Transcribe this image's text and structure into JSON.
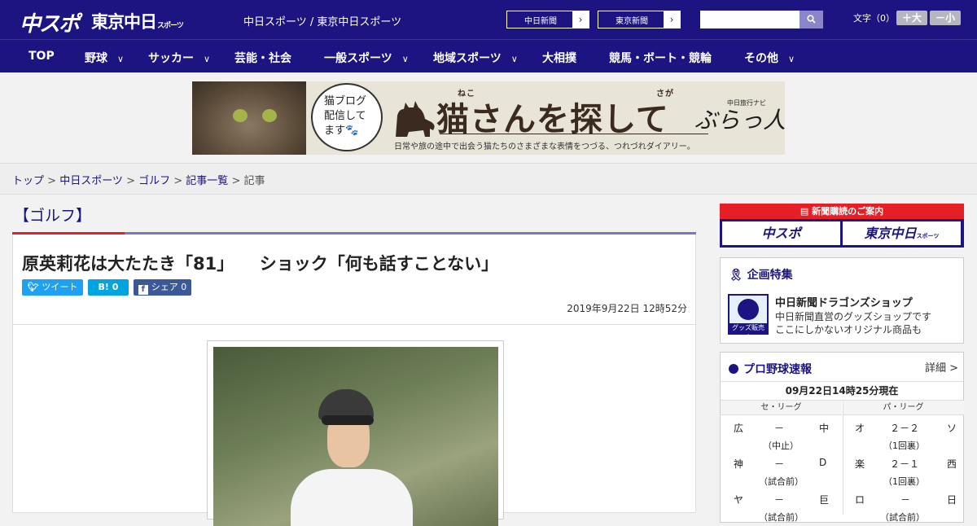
{
  "header": {
    "logo_main": "中スポ",
    "logo_tokyo": "東京中日",
    "logo_tokyo_suffix": "スポーツ",
    "site_links": "中日スポーツ / 東京中日スポーツ",
    "chunichi_shimbun": "中日新聞",
    "tokyo_shimbun": "東京新聞",
    "arrow": "›",
    "search_placeholder": "",
    "font_size_label": "文字（0）",
    "font_bigger": "＋大",
    "font_smaller": "－小"
  },
  "nav": {
    "items": [
      {
        "label": "TOP",
        "chev": ""
      },
      {
        "label": "野球",
        "chev": "∨"
      },
      {
        "label": "サッカー",
        "chev": "∨"
      },
      {
        "label": "芸能・社会",
        "chev": ""
      },
      {
        "label": "一般スポーツ",
        "chev": "∨"
      },
      {
        "label": "地域スポーツ",
        "chev": "∨"
      },
      {
        "label": "大相撲",
        "chev": ""
      },
      {
        "label": "競馬・ボート・競輪",
        "chev": ""
      },
      {
        "label": "その他",
        "chev": "∨"
      }
    ]
  },
  "banner": {
    "bubble_line1": "猫ブログ",
    "bubble_line2": "配信して",
    "bubble_line3": "ます🐾",
    "title": "猫さんを探して",
    "ruby_neko": "ねこ",
    "ruby_saga": "さが",
    "subtitle": "日常や旅の途中で出会う猫たちのさまざまな表情をつづる、つれづれダイアリー。",
    "brand": "ぶらっ人",
    "brand_small": "中日旅行ナビ"
  },
  "breadcrumb": {
    "items": [
      "トップ",
      "中日スポーツ",
      "ゴルフ",
      "記事一覧"
    ],
    "sep": " > ",
    "current": "記事"
  },
  "category": "【ゴルフ】",
  "article": {
    "headline": "原英莉花は大たたき「81」　　ショック「何も話すことない」",
    "tweet": "ツイート",
    "hatena": "B! 0",
    "share": "シェア 0",
    "date": "2019年9月22日 12時52分"
  },
  "sidebar": {
    "subscribe_header": "新聞購読のご案内",
    "sub_chuspo": "中スポ",
    "sub_tokyo": "東京中日",
    "sub_tokyo_suffix": "スポーツ",
    "feature_header": "企画特集",
    "shop_badge": "グッズ販売中",
    "shop_title": "中日新聞ドラゴンズショップ",
    "shop_line1": "中日新聞直営のグッズショップです",
    "shop_line2": "ここにしかないオリジナル商品も",
    "baseball_header": "プロ野球速報",
    "detail": "詳細 >",
    "as_of": "09月22日14時25分現在",
    "central": "セ・リーグ",
    "pacific": "パ・リーグ",
    "games_central": [
      {
        "home": "広",
        "score": "－",
        "away": "中",
        "status": "（中止）"
      },
      {
        "home": "神",
        "score": "－",
        "away": "D",
        "status": "（試合前）"
      },
      {
        "home": "ヤ",
        "score": "－",
        "away": "巨",
        "status": "（試合前）"
      }
    ],
    "games_pacific": [
      {
        "home": "オ",
        "score": "２－２",
        "away": "ソ",
        "status": "（1回裏）"
      },
      {
        "home": "楽",
        "score": "２－１",
        "away": "西",
        "status": "（1回裏）"
      },
      {
        "home": "ロ",
        "score": "－",
        "away": "日",
        "status": "（試合前）"
      }
    ]
  }
}
